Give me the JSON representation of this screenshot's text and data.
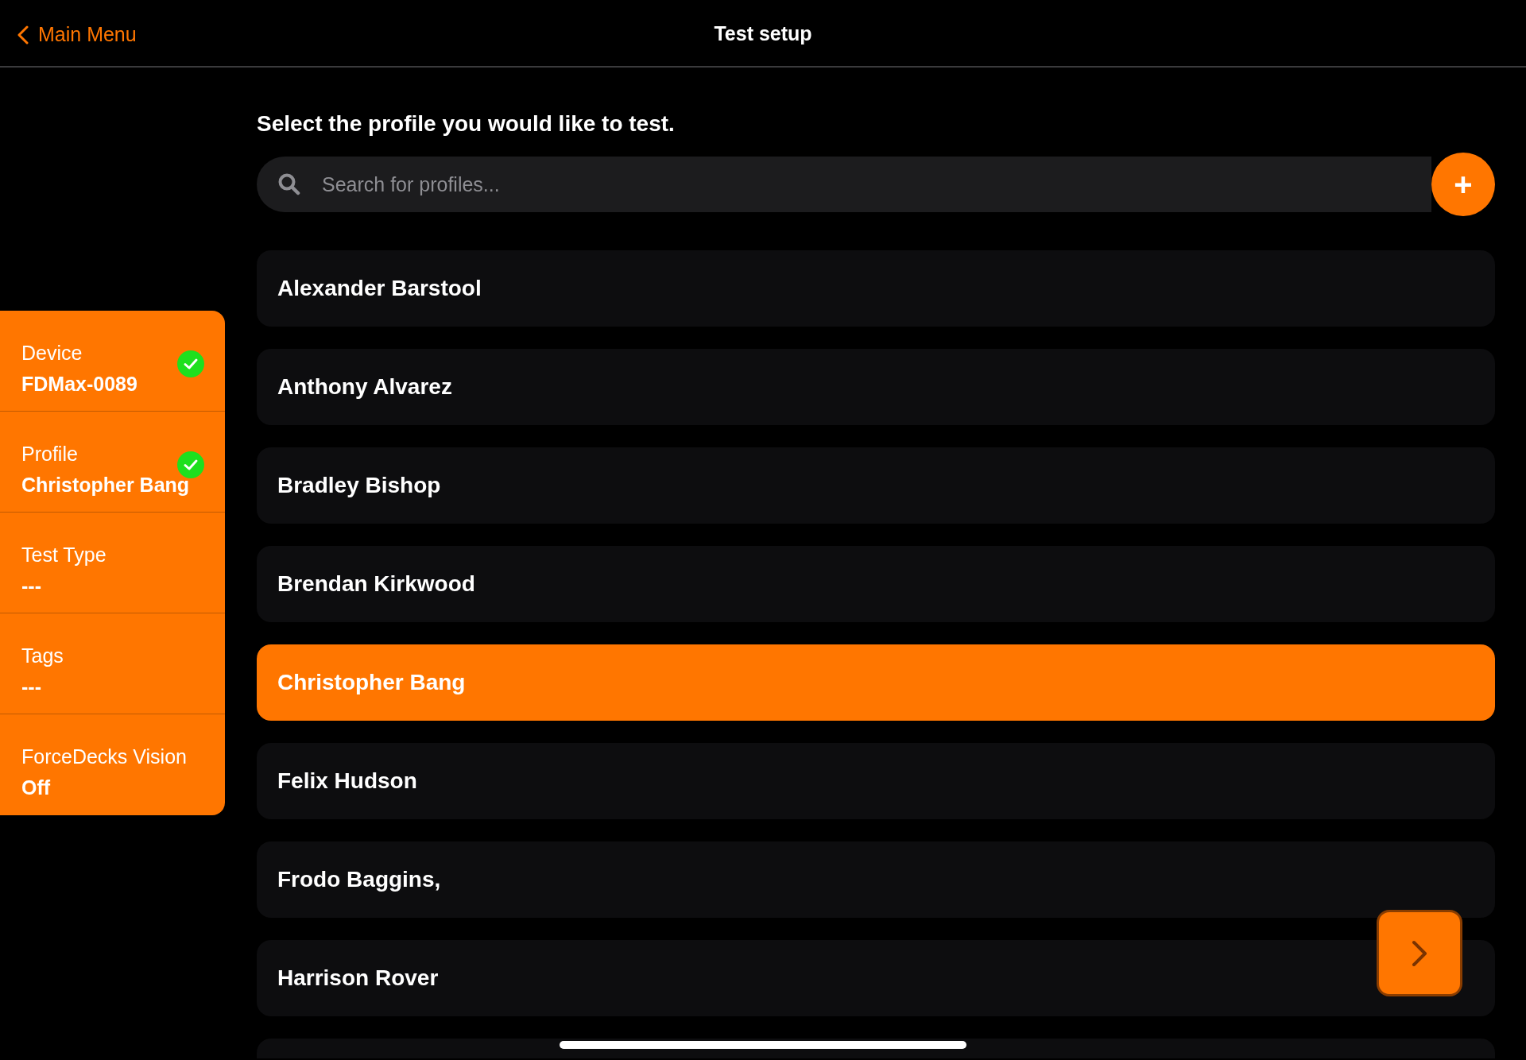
{
  "header": {
    "back": "Main Menu",
    "title": "Test setup"
  },
  "sidebar": {
    "items": [
      {
        "label": "Device",
        "value": "FDMax-0089",
        "done": true
      },
      {
        "label": "Profile",
        "value": "Christopher Bang",
        "done": true
      },
      {
        "label": "Test Type",
        "value": "---",
        "done": false
      },
      {
        "label": "Tags",
        "value": "---",
        "done": false
      },
      {
        "label": "ForceDecks Vision",
        "value": "Off",
        "done": false
      }
    ]
  },
  "prompt": "Select the profile you would like to test.",
  "search": {
    "placeholder": "Search for profiles..."
  },
  "add_button": "+",
  "profiles": [
    {
      "name": "Alexander Barstool",
      "selected": false
    },
    {
      "name": "Anthony Alvarez",
      "selected": false
    },
    {
      "name": "Bradley Bishop",
      "selected": false
    },
    {
      "name": "Brendan Kirkwood",
      "selected": false
    },
    {
      "name": "Christopher Bang",
      "selected": true
    },
    {
      "name": "Felix Hudson",
      "selected": false
    },
    {
      "name": "Frodo Baggins,",
      "selected": false
    },
    {
      "name": "Harrison Rover",
      "selected": false
    },
    {
      "selected": false
    }
  ]
}
